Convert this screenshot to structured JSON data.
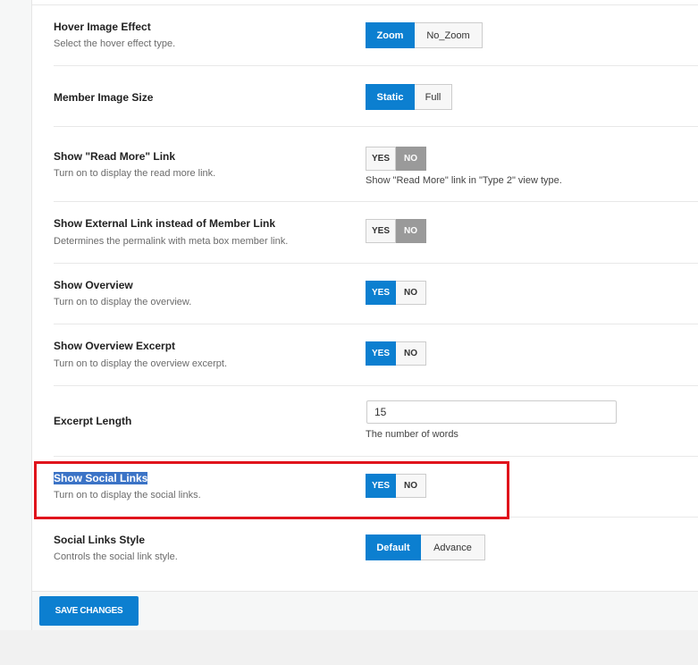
{
  "settings": {
    "hover_effect": {
      "label": "Hover Image Effect",
      "desc": "Select the hover effect type.",
      "options": [
        "Zoom",
        "No_Zoom"
      ],
      "selected": "Zoom"
    },
    "image_size": {
      "label": "Member Image Size",
      "options": [
        "Static",
        "Full"
      ],
      "selected": "Static"
    },
    "read_more": {
      "label": "Show \"Read More\" Link",
      "desc": "Turn on to display the read more link.",
      "yes": "YES",
      "no": "NO",
      "value": "NO",
      "hint": "Show \"Read More\" link in \"Type 2\" view type."
    },
    "external_link": {
      "label": "Show External Link instead of Member Link",
      "desc": "Determines the permalink with meta box member link.",
      "yes": "YES",
      "no": "NO",
      "value": "NO"
    },
    "overview": {
      "label": "Show Overview",
      "desc": "Turn on to display the overview.",
      "yes": "YES",
      "no": "NO",
      "value": "YES"
    },
    "overview_excerpt": {
      "label": "Show Overview Excerpt",
      "desc": "Turn on to display the overview excerpt.",
      "yes": "YES",
      "no": "NO",
      "value": "YES"
    },
    "excerpt_length": {
      "label": "Excerpt Length",
      "value": "15",
      "hint": "The number of words"
    },
    "social_links": {
      "label": "Show Social Links",
      "desc": "Turn on to display the social links.",
      "yes": "YES",
      "no": "NO",
      "value": "YES"
    },
    "social_style": {
      "label": "Social Links Style",
      "desc": "Controls the social link style.",
      "options": [
        "Default",
        "Advance"
      ],
      "selected": "Default"
    }
  },
  "footer": {
    "save_label": "SAVE CHANGES"
  },
  "colors": {
    "accent": "#0c7fd0",
    "off_state": "#9a9a9a",
    "annotation_box": "#e0141c"
  }
}
